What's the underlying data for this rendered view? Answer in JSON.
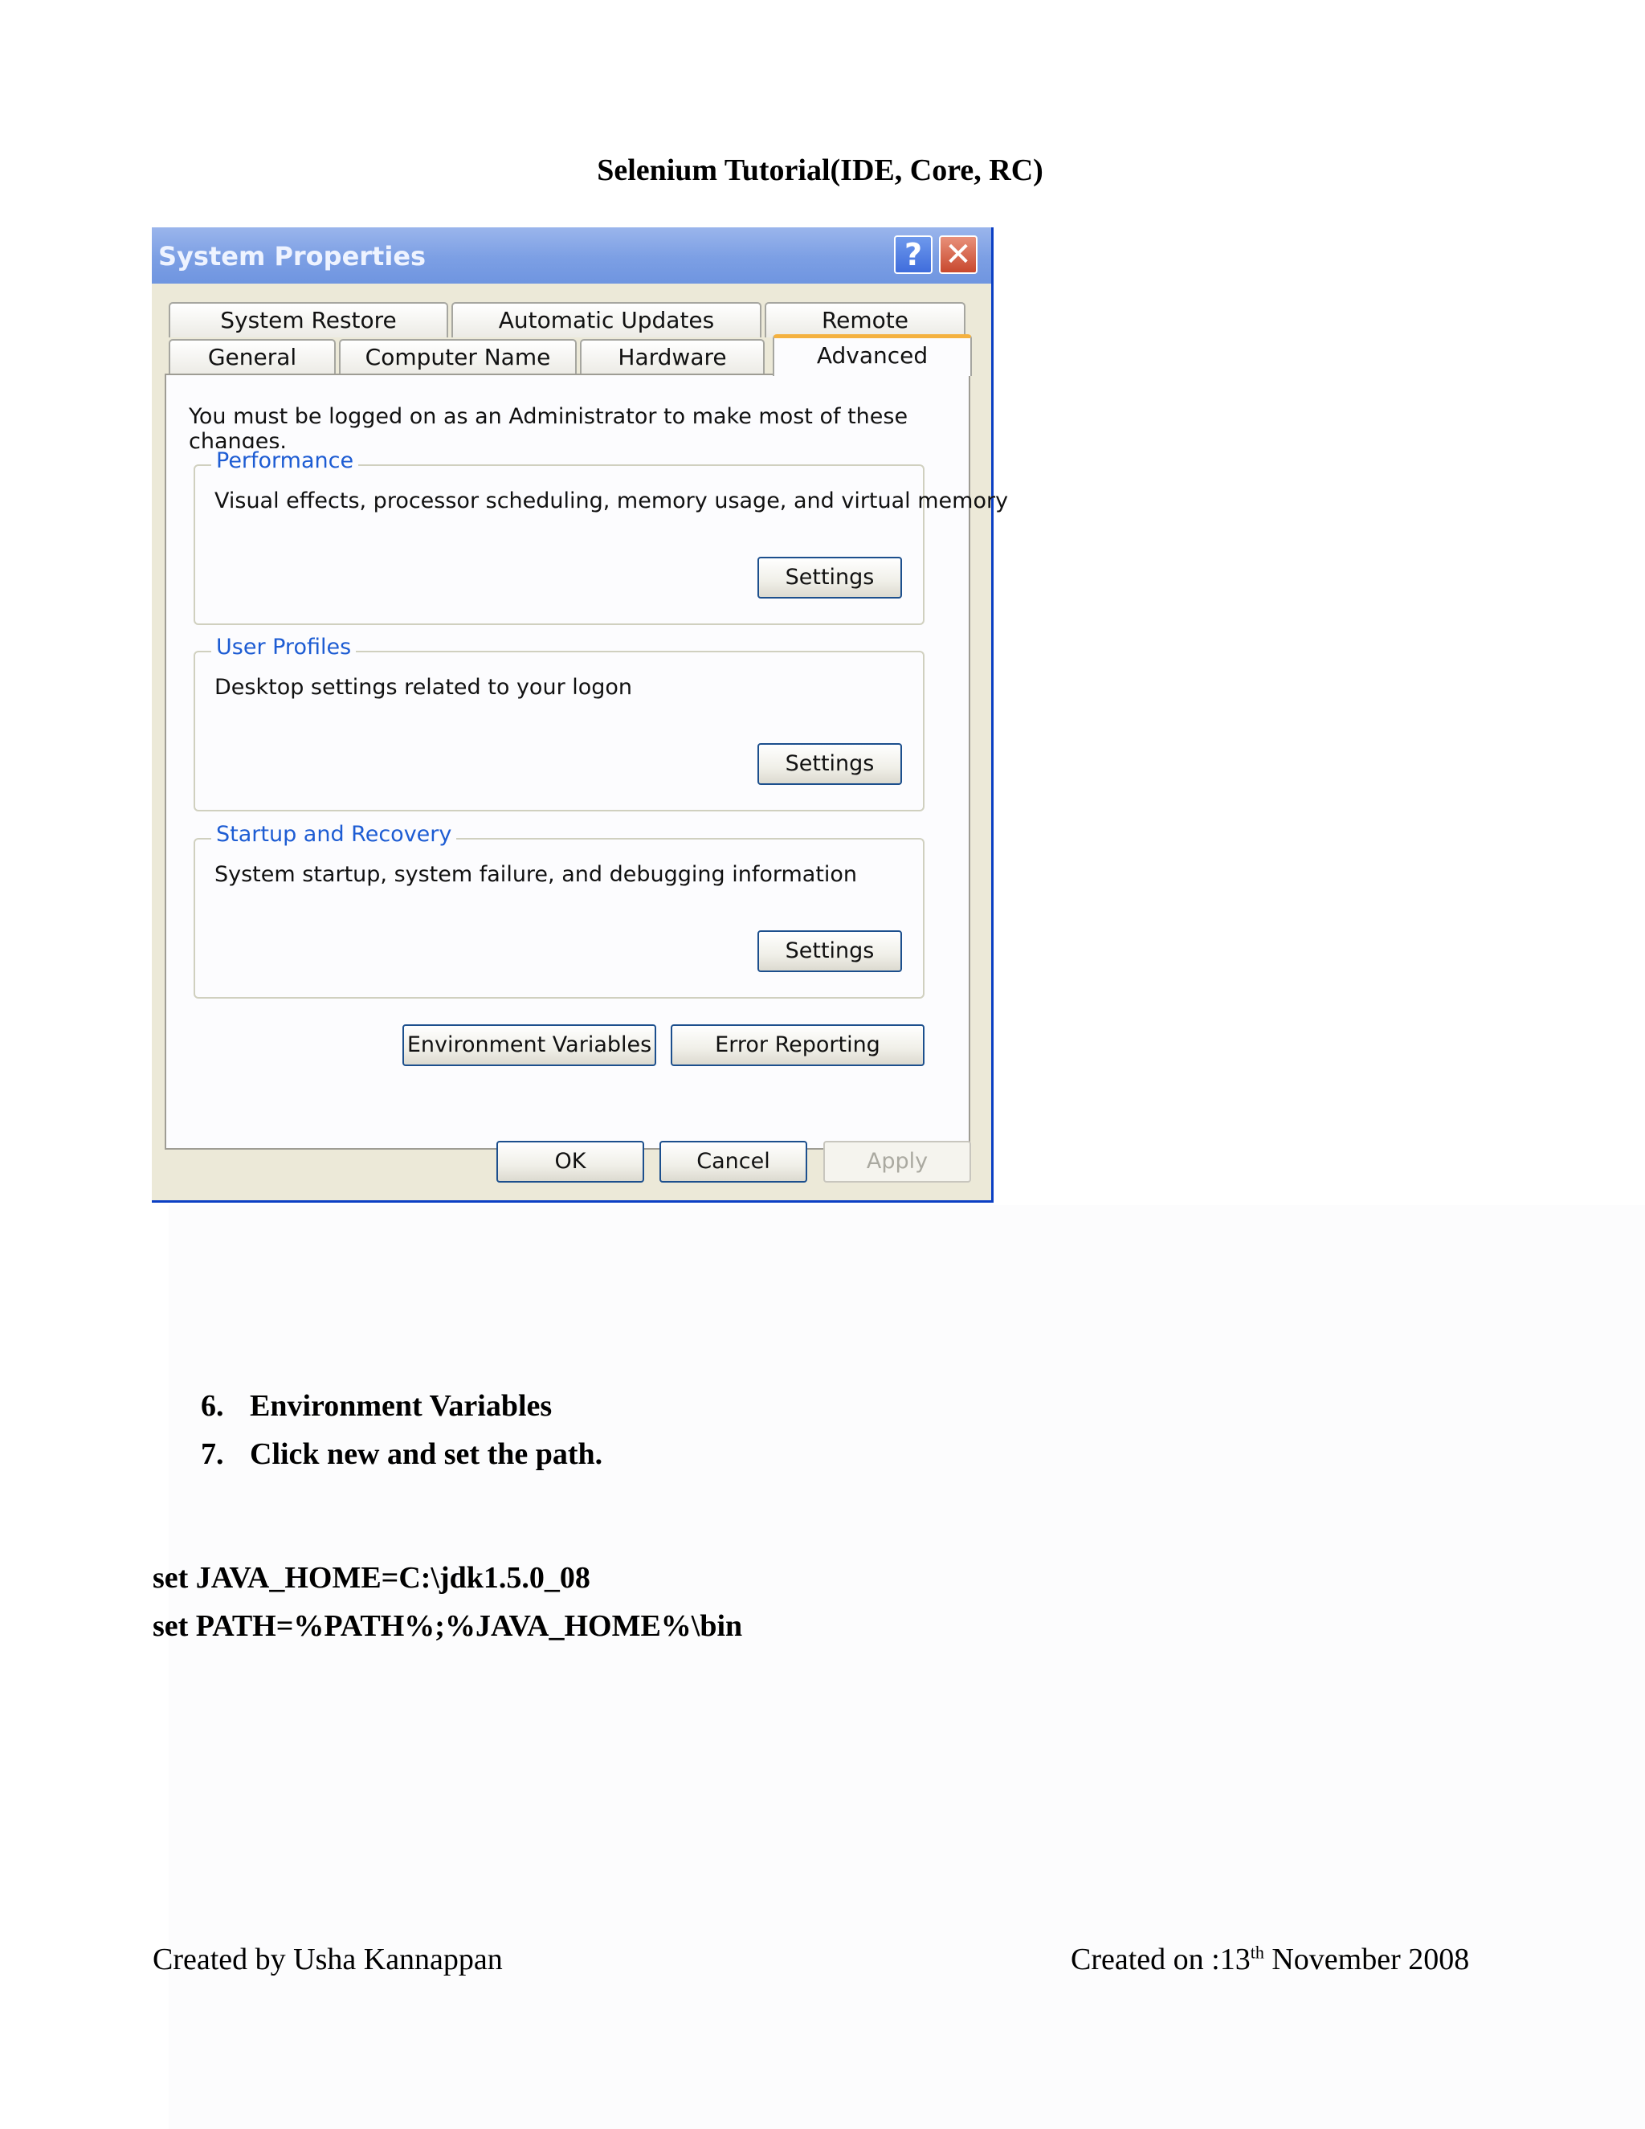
{
  "document": {
    "title": "Selenium Tutorial(IDE, Core, RC)",
    "steps": [
      {
        "number": "6.",
        "text": "Environment Variables"
      },
      {
        "number": "7.",
        "text": "Click new and set the path."
      }
    ],
    "commands": [
      "set JAVA_HOME=C:\\jdk1.5.0_08",
      "set PATH=%PATH%;%JAVA_HOME%\\bin"
    ],
    "footer": {
      "author": "Created by Usha Kannappan",
      "date_prefix": "Created on :13",
      "date_sup": "th",
      "date_suffix": " November 2008"
    }
  },
  "dialog": {
    "title": "System Properties",
    "help_glyph": "?",
    "close_glyph": "✕",
    "tabs_row1": [
      "System Restore",
      "Automatic Updates",
      "Remote"
    ],
    "tabs_row2": [
      "General",
      "Computer Name",
      "Hardware",
      "Advanced"
    ],
    "active_tab": "Advanced",
    "admin_note": "You must be logged on as an Administrator to make most of these changes.",
    "groups": [
      {
        "label": "Performance",
        "description": "Visual effects, processor scheduling, memory usage, and virtual memory",
        "button": "Settings"
      },
      {
        "label": "User Profiles",
        "description": "Desktop settings related to your logon",
        "button": "Settings"
      },
      {
        "label": "Startup and Recovery",
        "description": "System startup, system failure, and debugging information",
        "button": "Settings"
      }
    ],
    "env_button": "Environment Variables",
    "error_button": "Error Reporting",
    "ok_button": "OK",
    "cancel_button": "Cancel",
    "apply_button": "Apply",
    "colors": {
      "accent_tab": "#f4b13f",
      "group_label": "#1d5cd3",
      "title_bar": "#7c9fe4"
    }
  }
}
